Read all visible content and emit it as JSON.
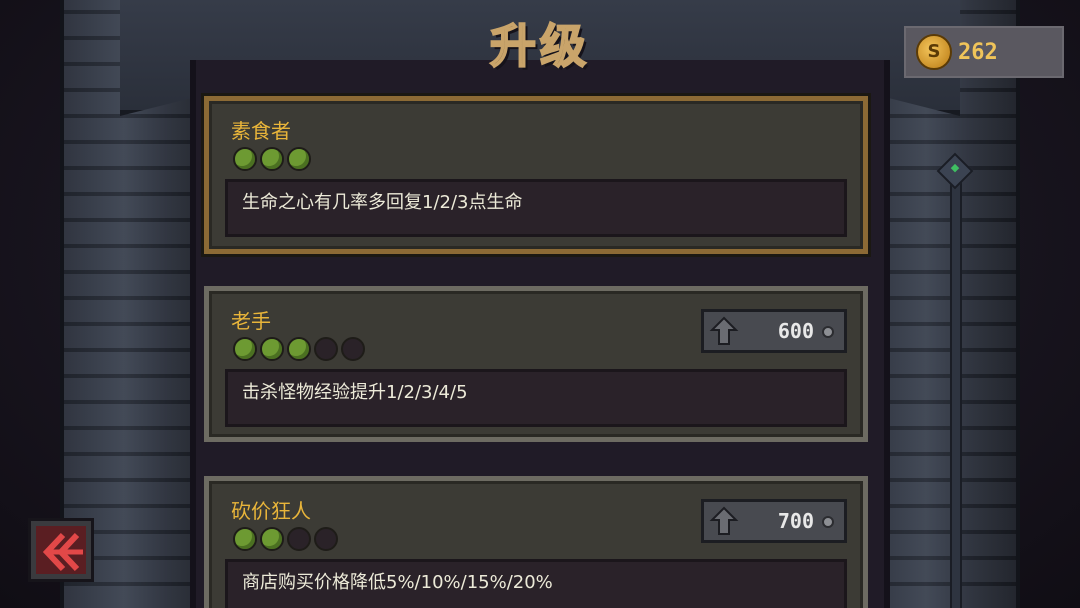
{
  "screen": {
    "title": "升级"
  },
  "currency": {
    "icon": "coin-icon",
    "amount": "262"
  },
  "upgrades": [
    {
      "name": "素食者",
      "level": 3,
      "max_level": 3,
      "description": "生命之心有几率多回复1/2/3点生命",
      "price": "",
      "maxed": true
    },
    {
      "name": "老手",
      "level": 3,
      "max_level": 5,
      "description": "击杀怪物经验提升1/2/3/4/5",
      "price": "600",
      "maxed": false
    },
    {
      "name": "砍价狂人",
      "level": 2,
      "max_level": 4,
      "description": "商店购买价格降低5%/10%/15%/20%",
      "price": "700",
      "maxed": false
    }
  ],
  "colors": {
    "gold": "#e9b53a",
    "pip_on": "#6d9a32",
    "pip_off": "#2a2228",
    "selected_border": "#8c6a35"
  }
}
